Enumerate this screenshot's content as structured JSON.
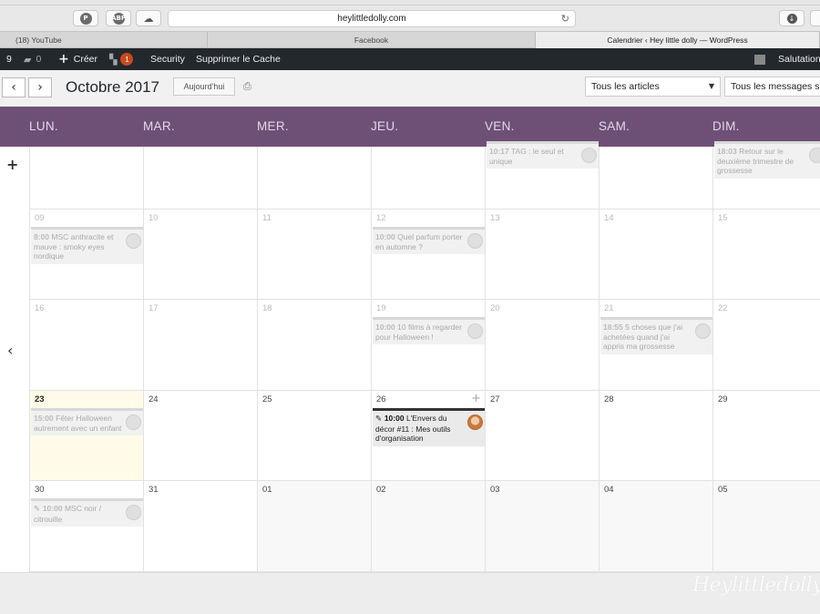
{
  "browser": {
    "url": "heylittledolly.com",
    "tabs": [
      {
        "label": "(18) YouTube"
      },
      {
        "label": "Facebook"
      },
      {
        "label": "Calendrier ‹ Hey little dolly — WordPress"
      }
    ]
  },
  "admin_bar": {
    "updates_count": "9",
    "comments_count": "0",
    "create_label": "Créer",
    "yoast_badge": "1",
    "security_label": "Security",
    "clear_cache_label": "Supprimer le Cache",
    "greeting": "Salutation"
  },
  "calendar": {
    "month_title": "Octobre 2017",
    "today_label": "Aujourd'hui",
    "filter_articles": "Tous les articles",
    "filter_messages": "Tous les messages s",
    "weekdays": [
      "LUN.",
      "MAR.",
      "MER.",
      "JEU.",
      "VEN.",
      "SAM.",
      "DIM."
    ],
    "weeks": [
      {
        "days": [
          {
            "num": "",
            "events": []
          },
          {
            "num": "",
            "events": []
          },
          {
            "num": "",
            "events": []
          },
          {
            "num": "",
            "events": []
          },
          {
            "num": "",
            "events": [
              {
                "time": "10:17",
                "title": "TAG : le seul et unique"
              }
            ]
          },
          {
            "num": "",
            "events": []
          },
          {
            "num": "",
            "events": [
              {
                "time": "18:03",
                "title": "Retour sur le deuxième trimestre de grossesse"
              }
            ]
          }
        ]
      },
      {
        "days": [
          {
            "num": "09",
            "events": [
              {
                "time": "8:00",
                "title": "MSC anthracite et mauve : smoky eyes nordique"
              }
            ]
          },
          {
            "num": "10",
            "events": []
          },
          {
            "num": "11",
            "events": []
          },
          {
            "num": "12",
            "events": [
              {
                "time": "10:00",
                "title": "Quel parfum porter en automne ?"
              }
            ]
          },
          {
            "num": "13",
            "events": []
          },
          {
            "num": "14",
            "events": []
          },
          {
            "num": "15",
            "events": []
          }
        ]
      },
      {
        "days": [
          {
            "num": "16",
            "events": []
          },
          {
            "num": "17",
            "events": []
          },
          {
            "num": "18",
            "events": []
          },
          {
            "num": "19",
            "events": [
              {
                "time": "10:00",
                "title": "10 films à regarder pour Halloween !"
              }
            ]
          },
          {
            "num": "20",
            "events": []
          },
          {
            "num": "21",
            "events": [
              {
                "time": "18:55",
                "title": "5 choses que j'ai achetées quand j'ai appris ma grossesse"
              }
            ]
          },
          {
            "num": "22",
            "events": []
          }
        ]
      },
      {
        "days": [
          {
            "num": "23",
            "events": [
              {
                "time": "15:00",
                "title": "Fêter Halloween autrement avec un enfant"
              }
            ]
          },
          {
            "num": "24",
            "events": []
          },
          {
            "num": "25",
            "events": []
          },
          {
            "num": "26",
            "events": [
              {
                "time": "10:00",
                "title": "L'Envers du décor #11 : Mes outils d'organisation"
              }
            ]
          },
          {
            "num": "27",
            "events": []
          },
          {
            "num": "28",
            "events": []
          },
          {
            "num": "29",
            "events": []
          }
        ]
      },
      {
        "days": [
          {
            "num": "30",
            "events": [
              {
                "time": "10:00",
                "title": "MSC noir / citrouille"
              }
            ]
          },
          {
            "num": "31",
            "events": []
          },
          {
            "num": "01",
            "events": []
          },
          {
            "num": "02",
            "events": []
          },
          {
            "num": "03",
            "events": []
          },
          {
            "num": "04",
            "events": []
          },
          {
            "num": "05",
            "events": []
          }
        ]
      }
    ]
  },
  "watermark": "Heylittledolly"
}
